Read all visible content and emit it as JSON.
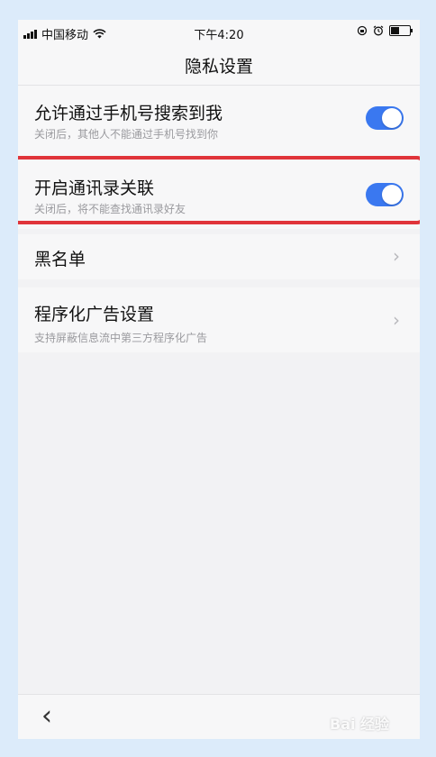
{
  "status_bar": {
    "carrier": "中国移动",
    "time": "下午4:20"
  },
  "nav": {
    "title": "隐私设置"
  },
  "settings": {
    "phone_search": {
      "title": "允许通过手机号搜索到我",
      "subtitle": "关闭后，其他人不能通过手机号找到你",
      "enabled": true
    },
    "contacts_link": {
      "title": "开启通讯录关联",
      "subtitle": "关闭后，将不能查找通讯录好友",
      "enabled": true
    },
    "blacklist": {
      "title": "黑名单"
    },
    "programmatic_ads": {
      "title": "程序化广告设置",
      "subtitle": "支持屏蔽信息流中第三方程序化广告"
    }
  },
  "watermark": "Bai 经验",
  "colors": {
    "toggle_on": "#3a78f0",
    "highlight": "#e0343a",
    "page_bg": "#dcebfa"
  }
}
